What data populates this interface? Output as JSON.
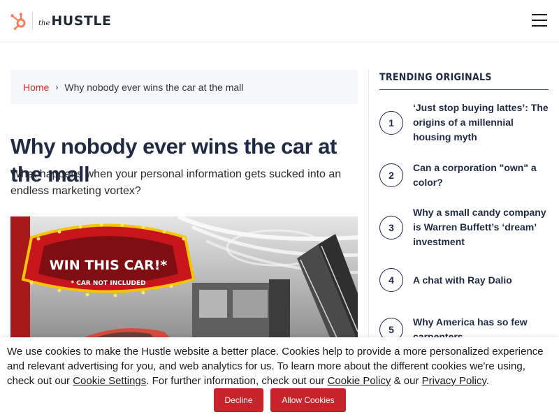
{
  "header": {
    "logo_the": "the",
    "logo_hustle": "HUSTLE"
  },
  "breadcrumb": {
    "home": "Home",
    "separator": "›",
    "current": "Why nobody ever wins the car at the mall"
  },
  "article": {
    "title": "Why nobody ever wins the car at the mall",
    "subtitle": "What happens when your personal information gets sucked into an endless marketing vortex?",
    "hero": {
      "sign_main": "WIN THIS CAR!*",
      "sign_note": "* CAR NOT INCLUDED"
    }
  },
  "sidebar": {
    "heading": "TRENDING ORIGINALS",
    "items": [
      {
        "num": "1",
        "title": "‘Just stop buying lattes’: The origins of a millennial housing myth"
      },
      {
        "num": "2",
        "title": "Can a corporation \"own\" a color?"
      },
      {
        "num": "3",
        "title": "Why a small candy company is Warren Buffett’s ‘dream’ investment"
      },
      {
        "num": "4",
        "title": "A chat with Ray Dalio"
      },
      {
        "num": "5",
        "title": "Why America has so few carpenters"
      }
    ]
  },
  "cookie": {
    "text_1": "We use cookies to make the Hustle website a better place. Cookies help to provide a more personalized experience and relevant advertising for you, and web analytics for us. To learn more about the different cookies we're using, check out our ",
    "link_settings": "Cookie Settings",
    "text_2": ". For further information, check out our ",
    "link_policy": "Cookie Policy",
    "text_3": " & our ",
    "link_privacy": "Privacy Policy",
    "text_4": ".",
    "decline": "Decline",
    "allow": "Allow Cookies"
  },
  "colors": {
    "brand_red": "#c8222a",
    "hubspot_orange": "#ff7a59",
    "navy": "#1f2a44"
  }
}
